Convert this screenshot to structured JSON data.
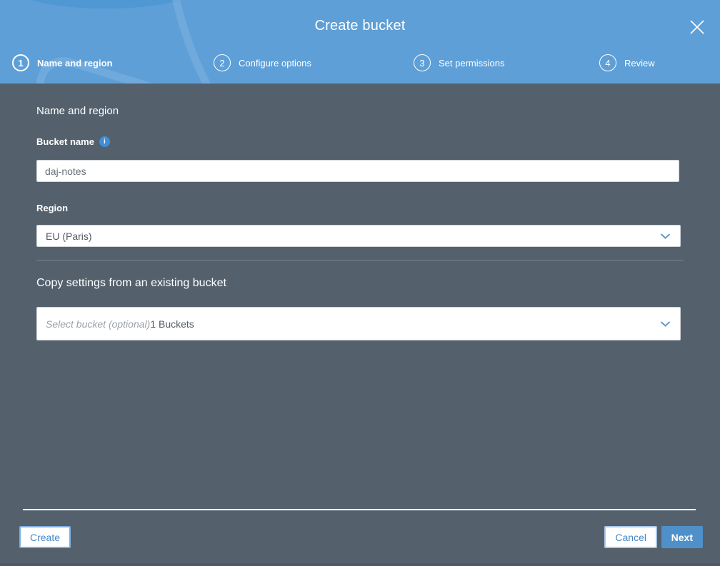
{
  "modal": {
    "title": "Create bucket"
  },
  "steps": [
    {
      "number": "1",
      "label": "Name and region"
    },
    {
      "number": "2",
      "label": "Configure options"
    },
    {
      "number": "3",
      "label": "Set permissions"
    },
    {
      "number": "4",
      "label": "Review"
    }
  ],
  "form": {
    "section_heading": "Name and region",
    "bucket_name_label": "Bucket name",
    "bucket_name_value": "daj-notes",
    "info_icon_glyph": "i",
    "region_label": "Region",
    "region_selected": "EU (Paris)",
    "copy_heading": "Copy settings from an existing bucket",
    "bucket_select_placeholder": "Select bucket (optional)",
    "bucket_select_count": "1 Buckets"
  },
  "footer": {
    "create": "Create",
    "cancel": "Cancel",
    "next": "Next"
  },
  "colors": {
    "header_blue": "#5e9fd7",
    "body_slate": "#54616d",
    "accent_blue": "#4586c8",
    "primary_button_blue": "#4f90ca"
  }
}
